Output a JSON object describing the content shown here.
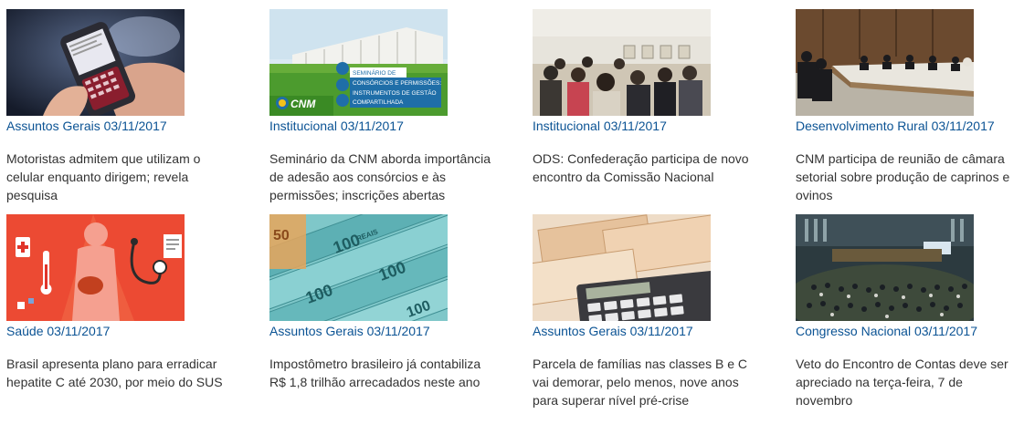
{
  "news": [
    {
      "category": "Assuntos Gerais",
      "date": "03/11/2017",
      "title": "Motoristas admitem que utilizam o celular enquanto dirigem; revela pesquisa"
    },
    {
      "category": "Institucional",
      "date": "03/11/2017",
      "title": "Seminário da CNM aborda importância de adesão aos consórcios e às permissões; inscrições abertas"
    },
    {
      "category": "Institucional",
      "date": "03/11/2017",
      "title": "ODS: Confederação participa de novo encontro da Comissão Nacional"
    },
    {
      "category": "Desenvolvimento Rural",
      "date": "03/11/2017",
      "title": "CNM participa de reunião de câmara setorial sobre produção de caprinos e ovinos"
    },
    {
      "category": "Saúde",
      "date": "03/11/2017",
      "title": "Brasil apresenta plano para erradicar hepatite C até 2030, por meio do SUS"
    },
    {
      "category": "Assuntos Gerais",
      "date": "03/11/2017",
      "title": "Impostômetro brasileiro já contabiliza R$ 1,8 trilhão arrecadados neste ano"
    },
    {
      "category": "Assuntos Gerais",
      "date": "03/11/2017",
      "title": "Parcela de famílias nas classes B e C vai demorar, pelo menos, nove anos para superar nível pré-crise"
    },
    {
      "category": "Congresso Nacional",
      "date": "03/11/2017",
      "title": "Veto do Encontro de Contas deve ser apreciado na terça-feira, 7 de novembro"
    }
  ],
  "banner": {
    "line1": "SEMINÁRIO DE",
    "line2": "CONSÓRCIOS E PERMISSÕES:",
    "line3": "INSTRUMENTOS DE GESTÃO",
    "line4": "COMPARTILHADA",
    "logo": "CNM"
  },
  "banknote": {
    "denomination": "100",
    "currency": "REAIS",
    "small_denomination": "50"
  }
}
